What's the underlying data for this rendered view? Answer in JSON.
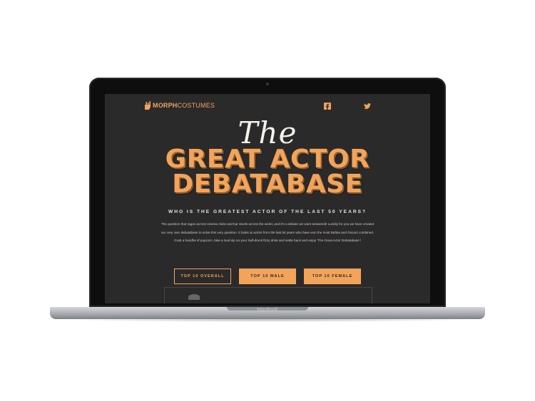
{
  "device": {
    "brand": "MacBook"
  },
  "header": {
    "logo_bold": "MORPH",
    "logo_rest": "COSTUMES",
    "social": [
      "facebook-icon",
      "twitter-icon"
    ]
  },
  "hero": {
    "script_title": "The",
    "title_line1": "GREAT ACTOR",
    "title_line2": "DEBATABASE"
  },
  "content": {
    "subheading": "WHO IS THE GREATEST ACTOR OF THE LAST 50 YEARS?",
    "intro": "The question that rages across cinema clubs and bar stools across the world, and it's a debate we want answered! Luckily for you we have created our very own debatabase to solve this very question. It looks at actors from the last 50 years who have won the most Baftas and Oscars combined. Grab a handful of popcorn, take a loud sip on your half-drunk fizzy drink and settle back and enjoy 'The Great Actor Debatabase'!"
  },
  "buttons": {
    "top_overall": "TOP 10 OVERALL",
    "top_male": "TOP 10 MALE",
    "top_female": "TOP 10 FEMALE"
  },
  "colors": {
    "accent": "#f2a45a",
    "background": "#2b2a2b"
  }
}
